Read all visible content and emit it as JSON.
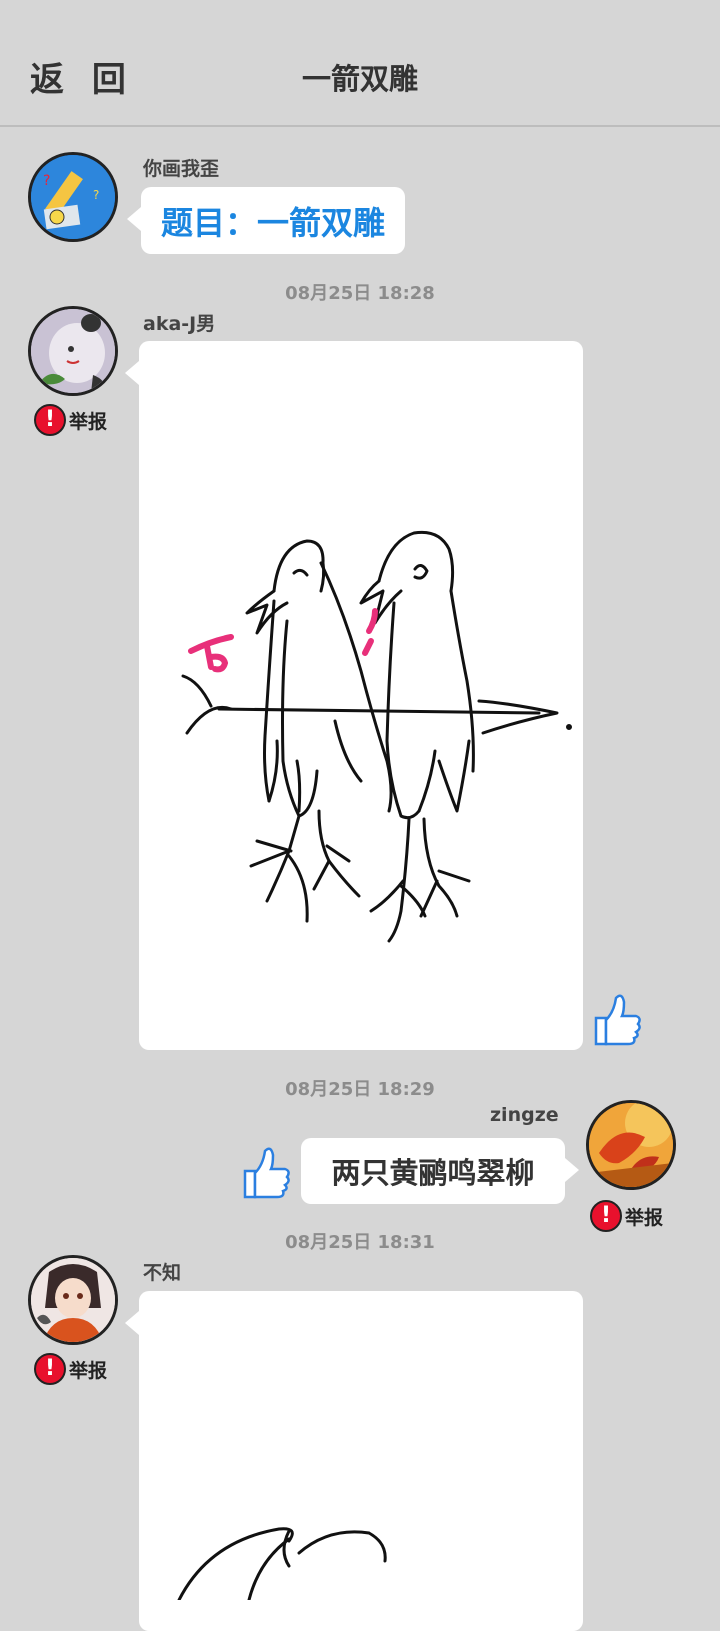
{
  "header": {
    "back_label": "返 回",
    "title": "一箭双雕"
  },
  "system_post": {
    "nickname": "你画我歪",
    "prompt_text": "题目：一箭双雕"
  },
  "messages": [
    {
      "time": "08月25日  18:28",
      "nickname": "aka-J男",
      "report_label": "举报"
    },
    {
      "time": "08月25日  18:29",
      "nickname": "zingze",
      "text": "两只黄鹂鸣翠柳",
      "report_label": "举报"
    },
    {
      "time": "08月25日  18:31",
      "nickname": "不知",
      "report_label": "举报"
    }
  ],
  "icons": {
    "report": "exclamation-icon",
    "like": "thumbs-up-icon"
  },
  "colors": {
    "background": "#d6d6d6",
    "accent_blue": "#1b86e0",
    "report_red": "#e8112d"
  }
}
